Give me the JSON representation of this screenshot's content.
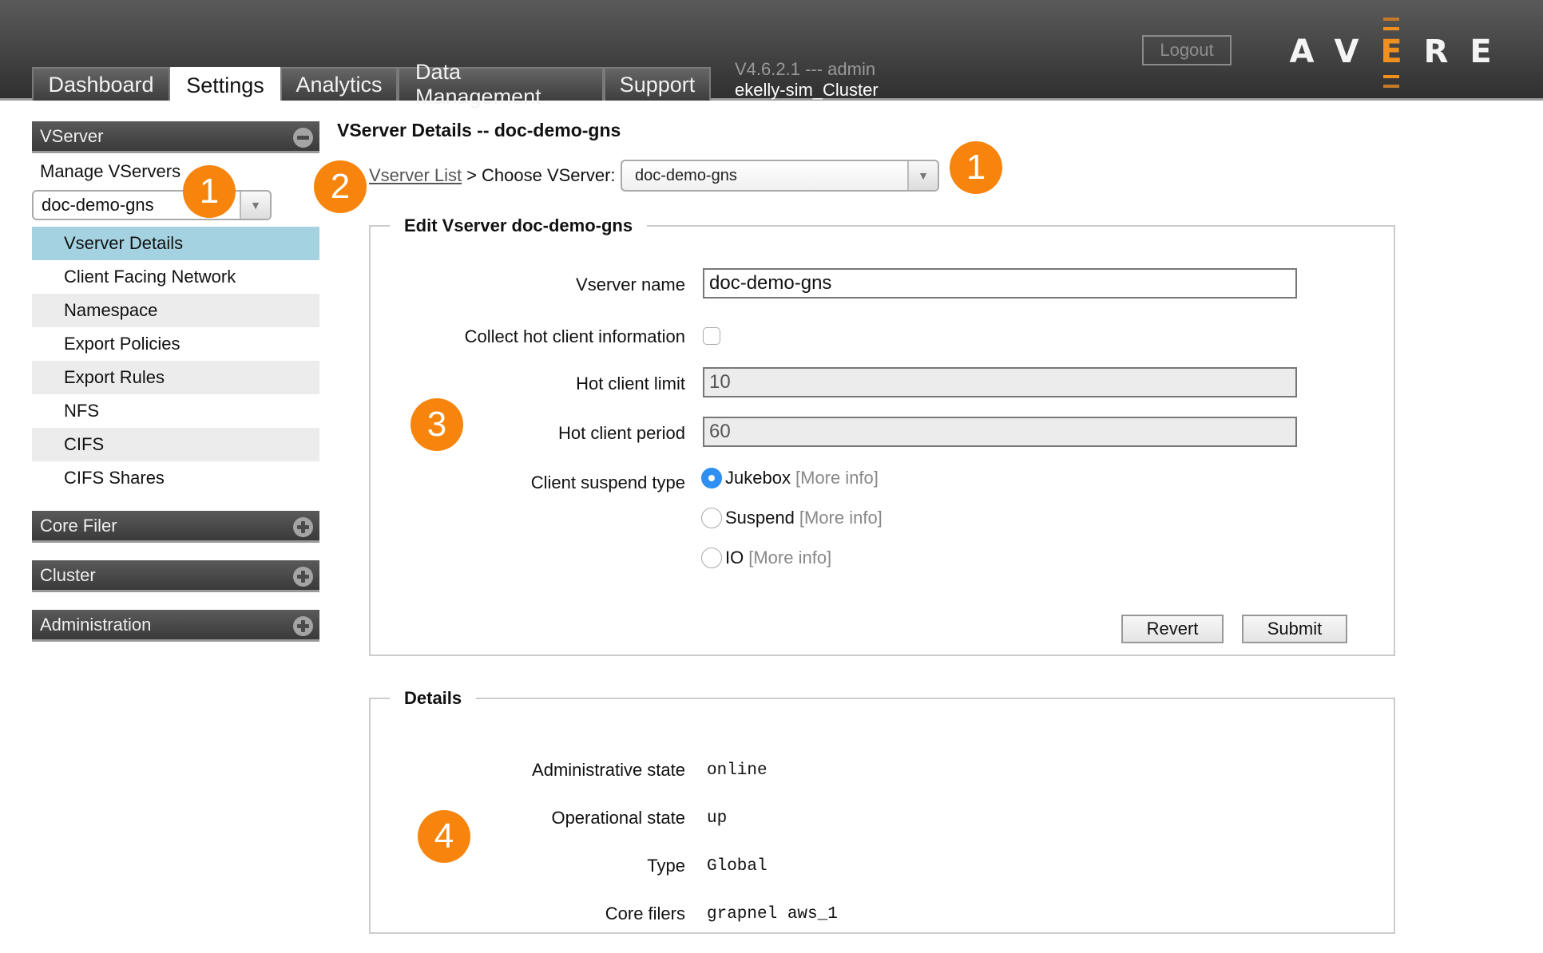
{
  "header": {
    "tabs": [
      {
        "label": "Dashboard",
        "active": false
      },
      {
        "label": "Settings",
        "active": true
      },
      {
        "label": "Analytics",
        "active": false
      },
      {
        "label": "Data Management",
        "active": false
      },
      {
        "label": "Support",
        "active": false
      }
    ],
    "version": "V4.6.2.1 --- admin",
    "cluster_name": "ekelly-sim_Cluster",
    "logout_label": "Logout",
    "logo_letters": [
      "A",
      "V",
      "E",
      "R",
      "E"
    ],
    "accent_color": "#f0901e"
  },
  "sidebar": {
    "vserver_panel": {
      "title": "VServer",
      "toggle_icon": "minus-circle-icon",
      "manage_label": "Manage VServers",
      "selected_vserver": "doc-demo-gns",
      "items": [
        {
          "label": "Vserver Details",
          "active": true
        },
        {
          "label": "Client Facing Network",
          "active": false
        },
        {
          "label": "Namespace",
          "active": false
        },
        {
          "label": "Export Policies",
          "active": false
        },
        {
          "label": "Export Rules",
          "active": false
        },
        {
          "label": "NFS",
          "active": false
        },
        {
          "label": "CIFS",
          "active": false
        },
        {
          "label": "CIFS Shares",
          "active": false
        }
      ]
    },
    "collapsed_panels": [
      {
        "title": "Core Filer",
        "toggle_icon": "plus-circle-icon"
      },
      {
        "title": "Cluster",
        "toggle_icon": "plus-circle-icon"
      },
      {
        "title": "Administration",
        "toggle_icon": "plus-circle-icon"
      }
    ]
  },
  "main": {
    "title": "VServer Details -- doc-demo-gns",
    "breadcrumb": {
      "link": "Vserver List",
      "separator": ">",
      "choose_label": "Choose VServer:",
      "selected": "doc-demo-gns"
    },
    "edit_form": {
      "legend": "Edit Vserver doc-demo-gns",
      "vserver_name_label": "Vserver name",
      "vserver_name_value": "doc-demo-gns",
      "collect_hot_label": "Collect hot client information",
      "collect_hot_checked": false,
      "hot_limit_label": "Hot client limit",
      "hot_limit_value": "10",
      "hot_period_label": "Hot client period",
      "hot_period_value": "60",
      "suspend_type_label": "Client suspend type",
      "suspend_options": [
        {
          "label": "Jukebox",
          "more": "[More info]",
          "selected": true
        },
        {
          "label": "Suspend",
          "more": "[More info]",
          "selected": false
        },
        {
          "label": "IO",
          "more": "[More info]",
          "selected": false
        }
      ],
      "revert_label": "Revert",
      "submit_label": "Submit"
    },
    "details": {
      "legend": "Details",
      "rows": [
        {
          "label": "Administrative state",
          "value": "online"
        },
        {
          "label": "Operational state",
          "value": "up"
        },
        {
          "label": "Type",
          "value": "Global"
        },
        {
          "label": "Core filers",
          "value": "grapnel aws_1"
        }
      ]
    }
  },
  "callouts": [
    "1",
    "2",
    "1",
    "3",
    "4"
  ]
}
